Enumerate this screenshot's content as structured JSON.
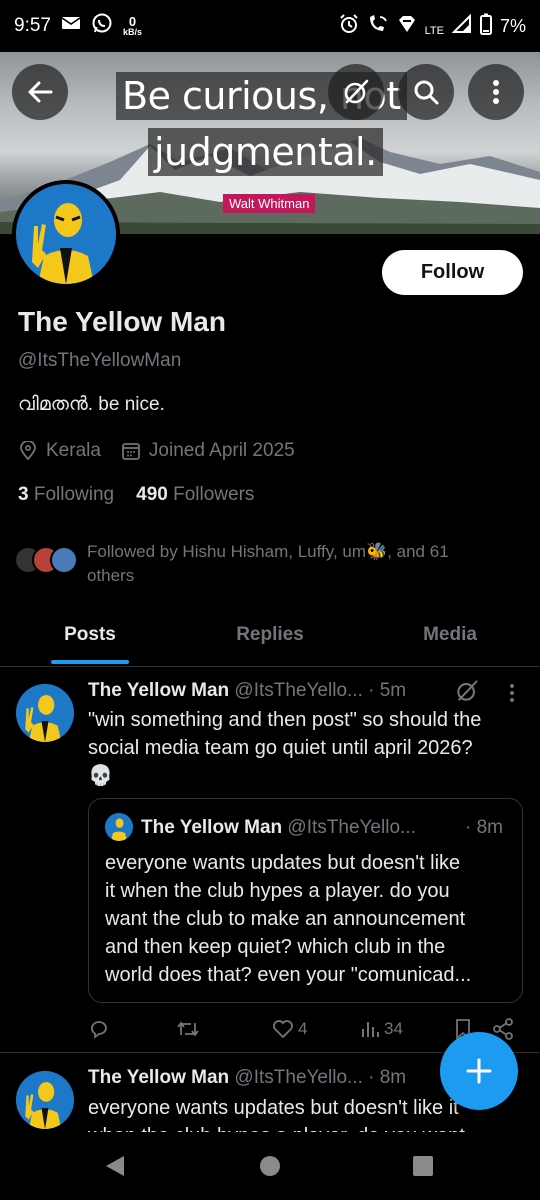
{
  "status_bar": {
    "time": "9:57",
    "net_speed_value": "0",
    "net_speed_unit": "kB/s",
    "network": "LTE",
    "battery": "7%"
  },
  "banner": {
    "quote_line1": "Be curious, not",
    "quote_line2": "judgmental.",
    "author": "Walt Whitman"
  },
  "profile": {
    "follow_label": "Follow",
    "name": "The Yellow Man",
    "handle": "@ItsTheYellowMan",
    "bio": "വിമതൻ. be nice.",
    "location": "Kerala",
    "joined": "Joined April 2025",
    "following_count": "3",
    "following_label": "Following",
    "followers_count": "490",
    "followers_label": "Followers",
    "followed_by_line1": "Followed by Hishu Hisham, Luffy, um🐝, and 61",
    "followed_by_line2": "others"
  },
  "tabs": [
    {
      "label": "Posts",
      "active": true
    },
    {
      "label": "Replies",
      "active": false
    },
    {
      "label": "Media",
      "active": false
    }
  ],
  "posts": [
    {
      "name": "The Yellow Man",
      "handle_time": "@ItsTheYello... · 5m",
      "text_line1": "\"win something and then post\" so should the",
      "text_line2": "social media team go quiet until april 2026?",
      "text_line3": "💀",
      "quoted": {
        "name": "The Yellow Man",
        "handle": "@ItsTheYello...",
        "time": "· 8m",
        "text_line1": "everyone wants updates but doesn't like",
        "text_line2": "it when the club hypes a player. do you",
        "text_line3": "want the club to make an announcement",
        "text_line4": "and then keep quiet? which club in the",
        "text_line5": "world does that? even your \"comunicad..."
      },
      "likes": "4",
      "views": "34"
    },
    {
      "name": "The Yellow Man",
      "handle_time": "@ItsTheYello... · 8m",
      "text_line1": "everyone wants updates but doesn't like it",
      "text_line2": "when the club hypes a player. do you want"
    }
  ],
  "colors": {
    "accent": "#1d9bf0",
    "background": "#000000",
    "secondary_text": "#71767b",
    "border": "#2f3336"
  }
}
